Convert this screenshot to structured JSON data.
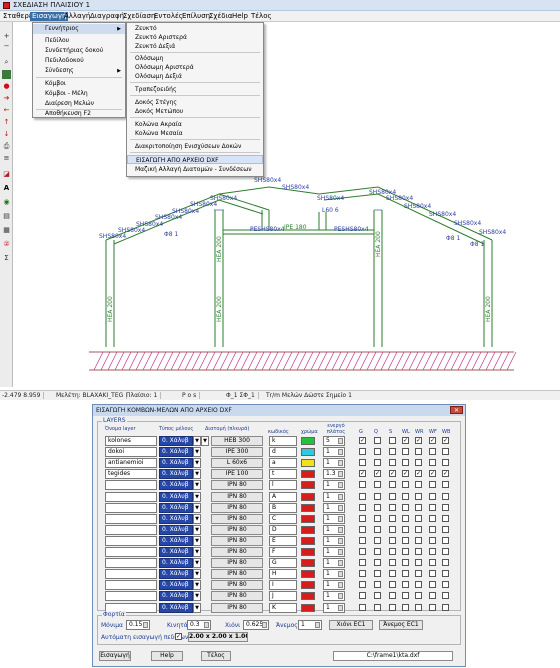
{
  "window": {
    "title": "ΣΧΕΔΙΑΣΗ ΠΛΑΙΣΙΟΥ 1"
  },
  "menubar": [
    "Σταθερές",
    "Εισαγωγή",
    "Αλλαγή",
    "Διαγραφή",
    "Σχεδίαση",
    "Εντολές",
    "Επίλυση",
    "Σχέδια",
    "Help",
    "Τέλος"
  ],
  "menu": {
    "items": [
      "Γεννήτριος",
      "Πεδίλου",
      "Συνδετήριας δοκού",
      "Πεδιλοδοκού",
      "Σύνδεσης",
      "Κόμβοι",
      "Κόμβοι - Μέλη",
      "Διαίρεση Μελών",
      "Αποθήκευση  F2"
    ]
  },
  "submenu": {
    "items": [
      "Ζευκτό",
      "Ζευκτό Αριστερά",
      "Ζευκτό Δεξιά",
      "Ολόσωμη",
      "Ολόσωμη Αριστερά",
      "Ολόσωμη Δεξιά",
      "Τραπεζοειδής",
      "Δοκός Στέγης",
      "Δοκός Μετώπου",
      "Κολώνα Ακραία",
      "Κολώνα Μεσαία",
      "Διακριτοποίηση Ενισχύσεων Δοκών",
      "ΕΙΣΑΓΩΓΗ ΑΠΟ ΑΡΧΕΙΟ DXF",
      "Μαζική Αλλαγή Διατομών - Συνδέσεων"
    ]
  },
  "drawing": {
    "top_labels": [
      "SHS80x4",
      "SHS80x4",
      "SHS80x4",
      "SHS80x4",
      "SHS80x4",
      "SHS80x4",
      "SHS80x4",
      "SHS80x4",
      "SHS80x4",
      "SHS80x4",
      "SHS80x4",
      "SHS80x4",
      "SHS80x4",
      "SHS80x4",
      "SHS80x4",
      "SHS80x4"
    ],
    "col_labels": [
      "HEA 200",
      "HEA 200",
      "HEA 200",
      "HEA 200",
      "HEA 200"
    ],
    "beam_labels": [
      "IPE 180",
      "IPE 180"
    ],
    "small_labels": [
      "PESHS80x4",
      "PESHS80x4",
      "Φ8 1",
      "L60 6",
      "Φ8 1",
      "IPE 180",
      "Φ8 1"
    ]
  },
  "statusbar": {
    "coords": "-2.479  8.959",
    "study": "Μελέτη: BLAXAKI_TEG",
    "frame": "Πλαίσιο: 1",
    "pos": "P o s",
    "mid": "Φ_1  ΣΦ_1",
    "hint": "Τr/m Μελών  Δώστε Σημείο 1"
  },
  "dialog": {
    "title": "ΕΙΣΑΓΩΓΗ ΚΟΜΒΩΝ-ΜΕΛΩΝ ΑΠΟ ΑΡΧΕΙΟ DXF",
    "group_layers": "LAYERS",
    "headers": {
      "name": "Όνομα layer",
      "type": "Τύπος μέλους",
      "section": "Διατομή (πλευρά)",
      "code": "κωδικός",
      "color": "χρώμα",
      "active": "ενεργό πλάτος",
      "G": "G",
      "Q": "Q",
      "S": "S",
      "WL": "WL",
      "WR": "WR",
      "WF": "WF",
      "WB": "WB"
    },
    "rows": [
      {
        "name": "kolones",
        "type": "0. Χάλυβ",
        "section": "HEB 300",
        "code": "k",
        "color": "#22c23a",
        "width": "5",
        "checks": [
          true,
          false,
          false,
          true,
          true,
          true,
          true
        ]
      },
      {
        "name": "dokoi",
        "type": "0. Χάλυβ",
        "section": "IPE 300",
        "code": "d",
        "color": "#2fc8e0",
        "width": "1",
        "checks": [
          false,
          false,
          false,
          false,
          false,
          false,
          false
        ]
      },
      {
        "name": "antianemioi",
        "type": "0. Χάλυβ",
        "section": "L 60x6",
        "code": "a",
        "color": "#f2e21a",
        "width": "1",
        "checks": [
          false,
          false,
          false,
          false,
          false,
          false,
          false
        ]
      },
      {
        "name": "tegides",
        "type": "0. Χάλυβ",
        "section": "IPE 100",
        "code": "t",
        "color": "#d81c1c",
        "width": "1.3",
        "checks": [
          true,
          true,
          true,
          true,
          true,
          true,
          true
        ]
      },
      {
        "name": "",
        "type": "0. Χάλυβ",
        "section": "IPN 80",
        "code": "l",
        "color": "#d81c1c",
        "width": "1",
        "checks": [
          false,
          false,
          false,
          false,
          false,
          false,
          false
        ]
      },
      {
        "name": "",
        "type": "0. Χάλυβ",
        "section": "IPN 80",
        "code": "A",
        "color": "#d81c1c",
        "width": "1",
        "checks": [
          false,
          false,
          false,
          false,
          false,
          false,
          false
        ]
      },
      {
        "name": "",
        "type": "0. Χάλυβ",
        "section": "IPN 80",
        "code": "B",
        "color": "#d81c1c",
        "width": "1",
        "checks": [
          false,
          false,
          false,
          false,
          false,
          false,
          false
        ]
      },
      {
        "name": "",
        "type": "0. Χάλυβ",
        "section": "IPN 80",
        "code": "C",
        "color": "#d81c1c",
        "width": "1",
        "checks": [
          false,
          false,
          false,
          false,
          false,
          false,
          false
        ]
      },
      {
        "name": "",
        "type": "0. Χάλυβ",
        "section": "IPN 80",
        "code": "D",
        "color": "#d81c1c",
        "width": "1",
        "checks": [
          false,
          false,
          false,
          false,
          false,
          false,
          false
        ]
      },
      {
        "name": "",
        "type": "0. Χάλυβ",
        "section": "IPN 80",
        "code": "E",
        "color": "#d81c1c",
        "width": "1",
        "checks": [
          false,
          false,
          false,
          false,
          false,
          false,
          false
        ]
      },
      {
        "name": "",
        "type": "0. Χάλυβ",
        "section": "IPN 80",
        "code": "F",
        "color": "#d81c1c",
        "width": "1",
        "checks": [
          false,
          false,
          false,
          false,
          false,
          false,
          false
        ]
      },
      {
        "name": "",
        "type": "0. Χάλυβ",
        "section": "IPN 80",
        "code": "G",
        "color": "#d81c1c",
        "width": "1",
        "checks": [
          false,
          false,
          false,
          false,
          false,
          false,
          false
        ]
      },
      {
        "name": "",
        "type": "0. Χάλυβ",
        "section": "IPN 80",
        "code": "H",
        "color": "#d81c1c",
        "width": "1",
        "checks": [
          false,
          false,
          false,
          false,
          false,
          false,
          false
        ]
      },
      {
        "name": "",
        "type": "0. Χάλυβ",
        "section": "IPN 80",
        "code": "I",
        "color": "#d81c1c",
        "width": "1",
        "checks": [
          false,
          false,
          false,
          false,
          false,
          false,
          false
        ]
      },
      {
        "name": "",
        "type": "0. Χάλυβ",
        "section": "IPN 80",
        "code": "J",
        "color": "#d81c1c",
        "width": "1",
        "checks": [
          false,
          false,
          false,
          false,
          false,
          false,
          false
        ]
      },
      {
        "name": "",
        "type": "0. Χάλυβ",
        "section": "IPN 80",
        "code": "K",
        "color": "#d81c1c",
        "width": "1",
        "checks": [
          false,
          false,
          false,
          false,
          false,
          false,
          false
        ]
      }
    ],
    "group_loads": "Φορτία",
    "loads": {
      "mon_label": "Μόνιμα",
      "mon_val": "0.15",
      "kin_label": "Κινητά",
      "kin_val": "0.3",
      "snow_label": "Χιόνι",
      "snow_val": "0.625",
      "wind_label": "Άνεμος",
      "wind_val": "1",
      "snow_btn": "Χιόνι EC1",
      "wind_btn": "Άνεμος EC1",
      "auto_label": "Αυτόματη εισαγωγή πεδίλων",
      "auto_btn": "2.00 x 2.00 x 1.00"
    },
    "footer": {
      "insert": "Εισαγωγή",
      "help": "Help",
      "end": "Τέλος",
      "file": "C:\\frame1\\kta.dxf"
    }
  }
}
